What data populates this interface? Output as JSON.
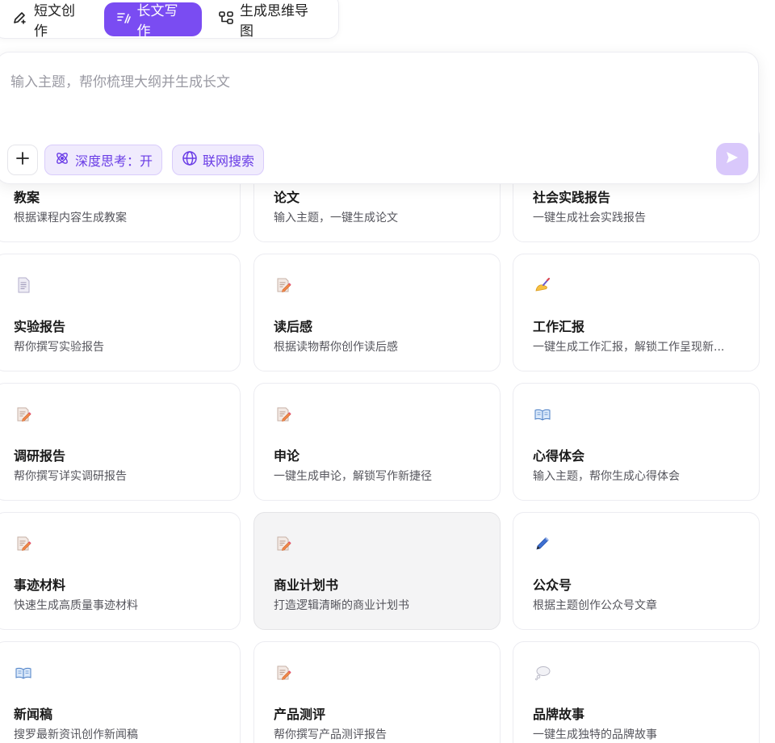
{
  "tabs": [
    {
      "label": "短文创作",
      "icon": "pen-sparkle-icon",
      "active": false
    },
    {
      "label": "长文写作",
      "icon": "long-text-icon",
      "active": true
    },
    {
      "label": "生成思维导图",
      "icon": "mind-map-icon",
      "active": false
    }
  ],
  "composer": {
    "placeholder": "输入主题，帮你梳理大纲并生成长文",
    "deep_think_label": "深度思考：开",
    "web_search_label": "联网搜索"
  },
  "colors": {
    "accent": "#7a4cf2",
    "chip_bg": "#f0ebfd",
    "send_disabled": "#d9c8fb"
  },
  "cards": [
    {
      "title": "教案",
      "desc": "根据课程内容生成教案",
      "icon": "lesson-plan-icon"
    },
    {
      "title": "论文",
      "desc": "输入主题，一键生成论文",
      "icon": "paper-icon"
    },
    {
      "title": "社会实践报告",
      "desc": "一键生成社会实践报告",
      "icon": "report-icon"
    },
    {
      "title": "实验报告",
      "desc": "帮你撰写实验报告",
      "icon": "page-facing-up-icon"
    },
    {
      "title": "读后感",
      "desc": "根据读物帮你创作读后感",
      "icon": "memo-icon"
    },
    {
      "title": "工作汇报",
      "desc": "一键生成工作汇报，解锁工作呈现新...",
      "icon": "writing-hand-icon"
    },
    {
      "title": "调研报告",
      "desc": "帮你撰写详实调研报告",
      "icon": "memo-icon"
    },
    {
      "title": "申论",
      "desc": "一键生成申论，解锁写作新捷径",
      "icon": "memo-icon"
    },
    {
      "title": "心得体会",
      "desc": "输入主题，帮你生成心得体会",
      "icon": "open-book-icon"
    },
    {
      "title": "事迹材料",
      "desc": "快速生成高质量事迹材料",
      "icon": "memo-icon"
    },
    {
      "title": "商业计划书",
      "desc": "打造逻辑清晰的商业计划书",
      "icon": "memo-icon"
    },
    {
      "title": "公众号",
      "desc": "根据主题创作公众号文章",
      "icon": "pen-icon"
    },
    {
      "title": "新闻稿",
      "desc": "搜罗最新资讯创作新闻稿",
      "icon": "open-book-icon"
    },
    {
      "title": "产品测评",
      "desc": "帮你撰写产品测评报告",
      "icon": "memo-icon"
    },
    {
      "title": "品牌故事",
      "desc": "一键生成独特的品牌故事",
      "icon": "thought-balloon-icon"
    }
  ]
}
